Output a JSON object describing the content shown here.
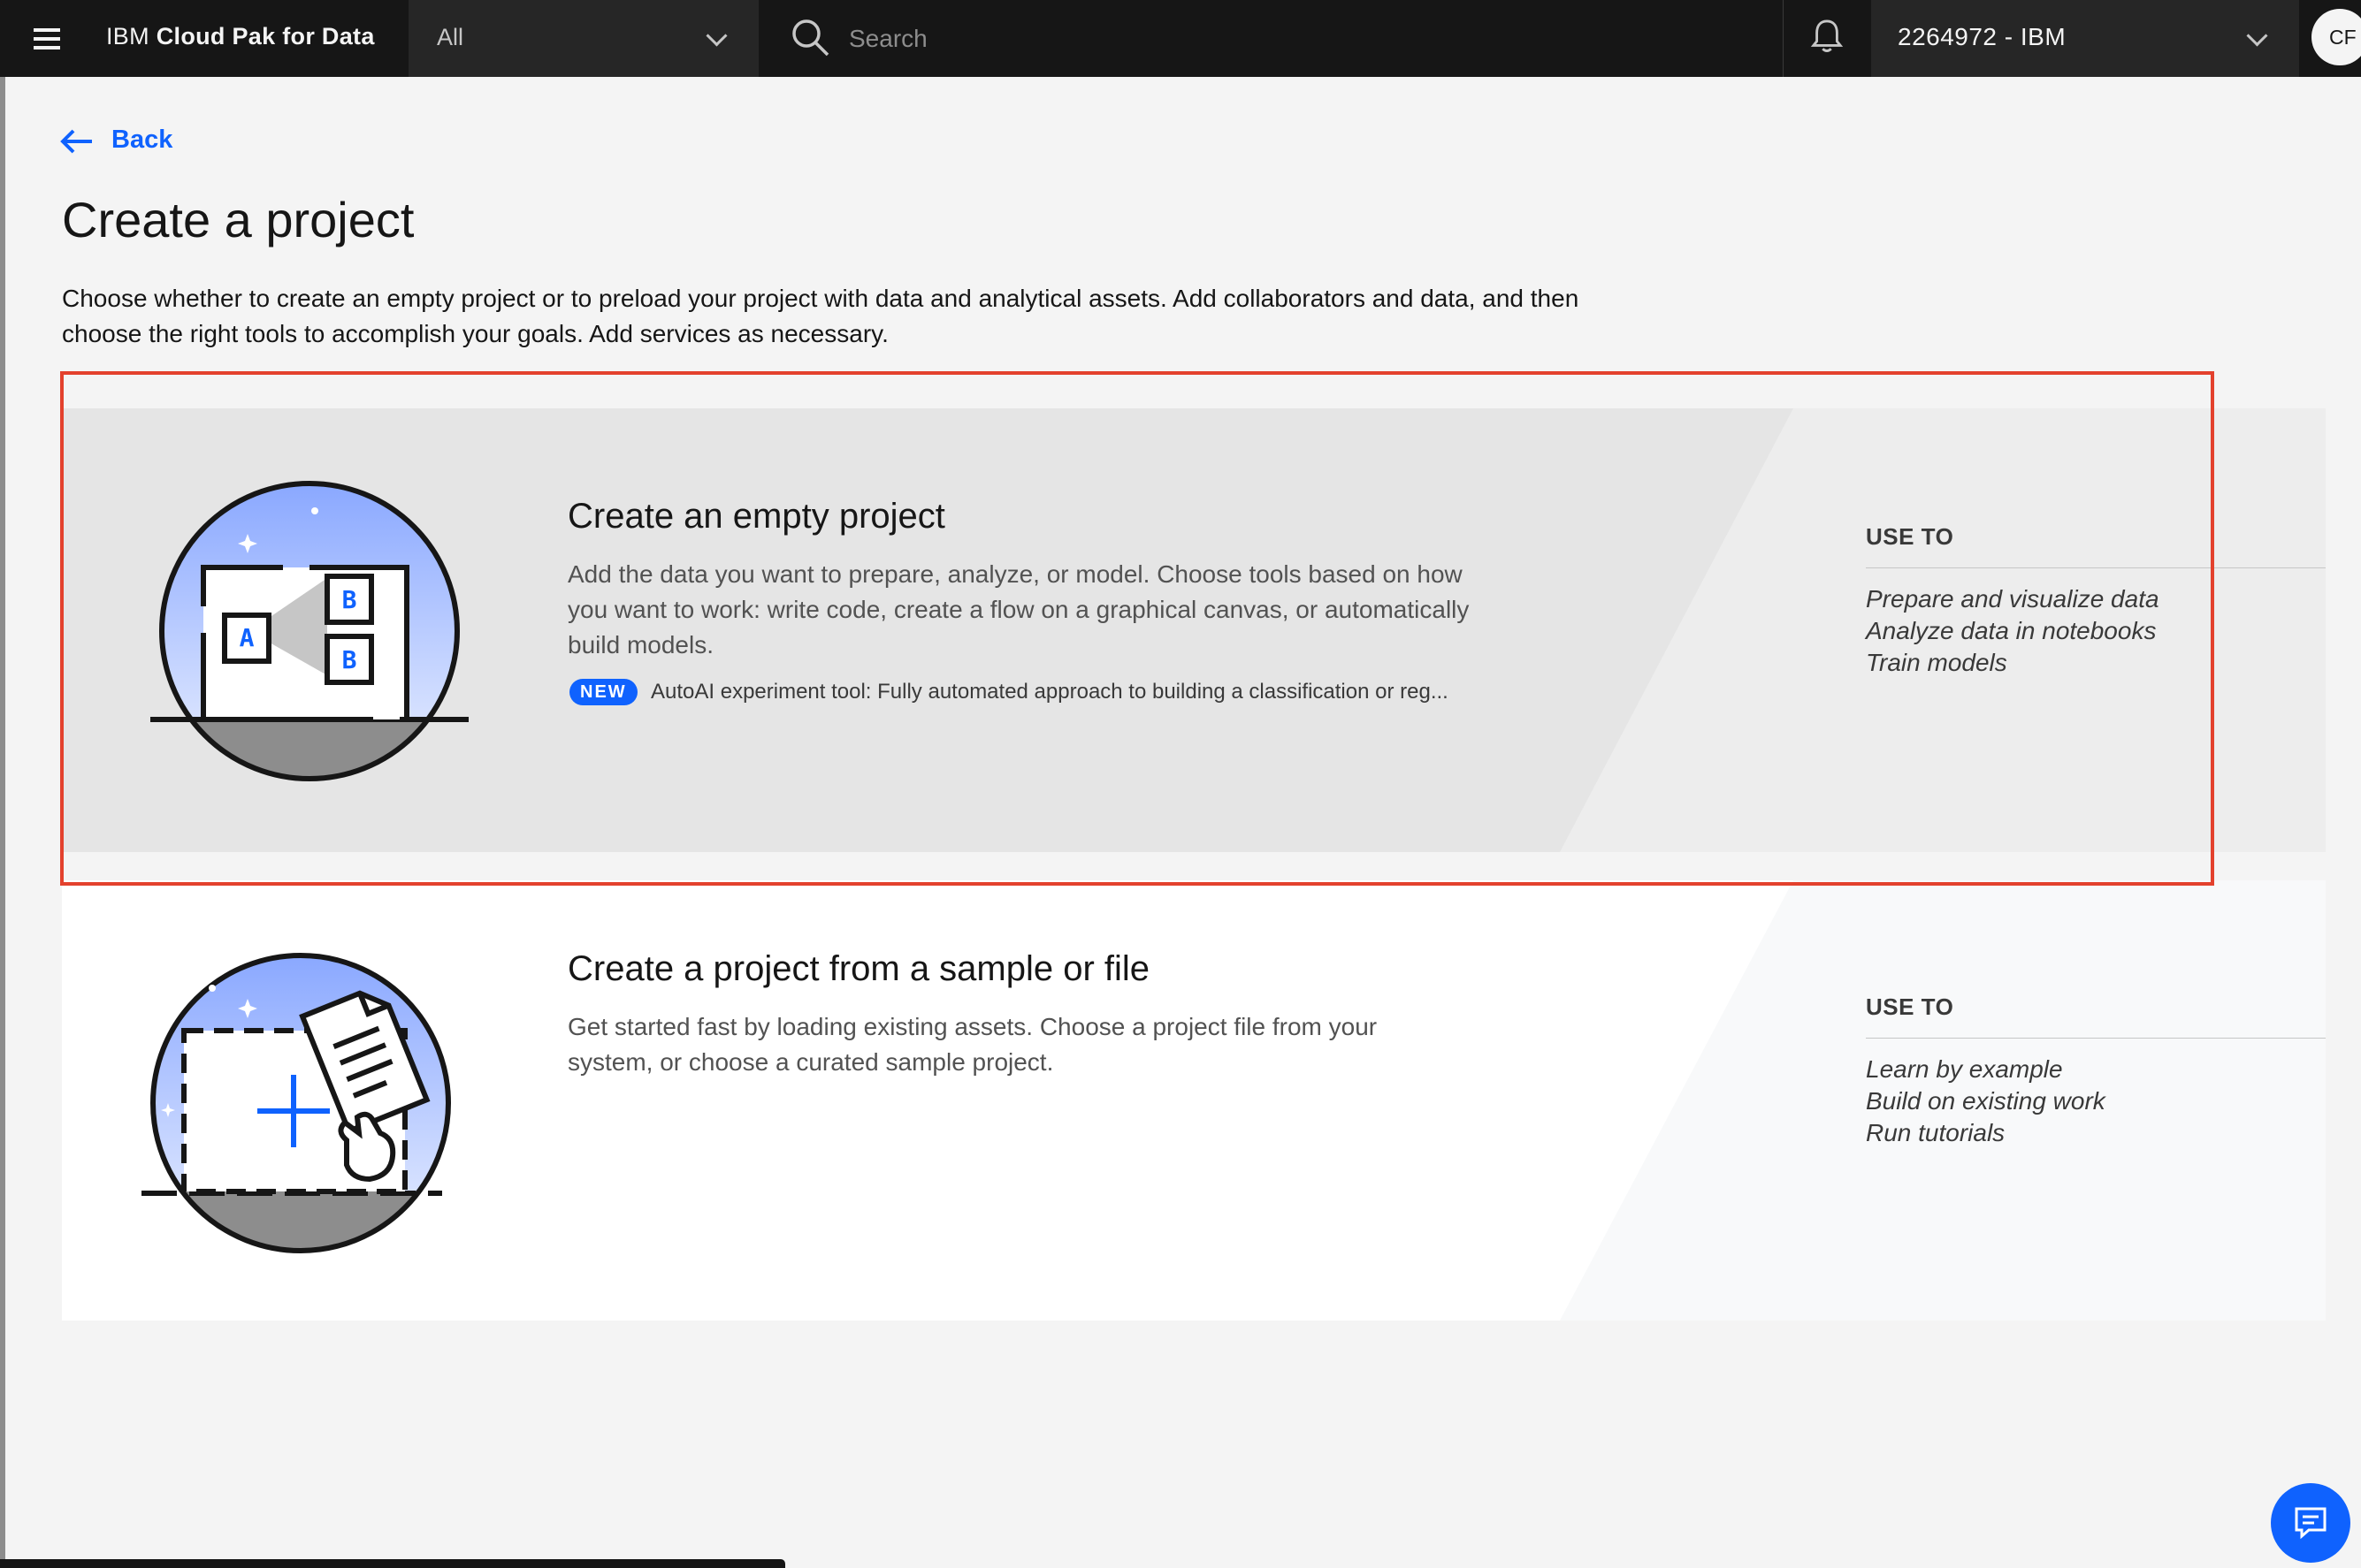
{
  "header": {
    "brand_prefix": "IBM",
    "brand_name": "Cloud Pak for Data",
    "scope_value": "All",
    "search_placeholder": "Search",
    "account_label": "2264972 - IBM",
    "avatar_initials": "CF"
  },
  "nav": {
    "back_label": "Back"
  },
  "page": {
    "title": "Create a project",
    "description": "Choose whether to create an empty project or to preload your project with data and analytical assets. Add collaborators and data, and then choose the right tools to accomplish your goals. Add services as necessary."
  },
  "cards": [
    {
      "title": "Create an empty project",
      "description": "Add the data you want to prepare, analyze, or model. Choose tools based on how you want to work: write code, create a flow on a graphical canvas, or automatically build models.",
      "tag": "NEW",
      "tag_text": "AutoAI experiment tool: Fully automated approach to building a classification or reg...",
      "use_heading": "USE TO",
      "use_items": [
        "Prepare and visualize data",
        "Analyze data in notebooks",
        "Train models"
      ],
      "illustration_letters": [
        "A",
        "B",
        "B"
      ]
    },
    {
      "title": "Create a project from a sample or file",
      "description": "Get started fast by loading existing assets. Choose a project file from your system, or choose a curated sample project.",
      "use_heading": "USE TO",
      "use_items": [
        "Learn by example",
        "Build on existing work",
        "Run tutorials"
      ]
    }
  ],
  "colors": {
    "accent": "#0f62fe",
    "highlight": "#e3412d",
    "header_bg": "#161616"
  },
  "icons": [
    "menu-icon",
    "chevron-down-icon",
    "search-icon",
    "notification-icon",
    "arrow-left-icon",
    "chat-icon"
  ]
}
